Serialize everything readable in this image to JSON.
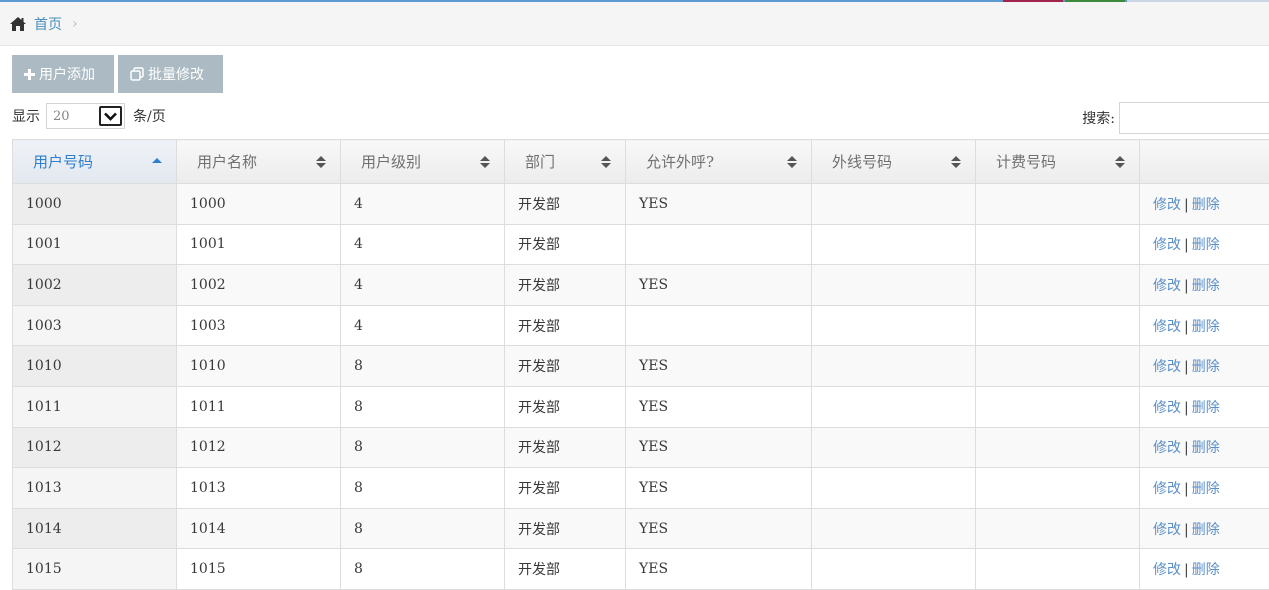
{
  "breadcrumb": {
    "home": "首页",
    "separator": "›"
  },
  "toolbar": {
    "add_label": "用户添加",
    "batch_label": "批量修改"
  },
  "length": {
    "prefix": "显示",
    "value": "20",
    "suffix": "条/页"
  },
  "search": {
    "label": "搜索:",
    "value": ""
  },
  "table": {
    "columns": [
      "用户号码",
      "用户名称",
      "用户级别",
      "部门",
      "允许外呼?",
      "外线号码",
      "计费号码",
      ""
    ],
    "sorted_column": 0,
    "rows": [
      {
        "number": "1000",
        "name": "1000",
        "level": "4",
        "dept": "开发部",
        "outbound": "YES",
        "trunk": "",
        "billing": ""
      },
      {
        "number": "1001",
        "name": "1001",
        "level": "4",
        "dept": "开发部",
        "outbound": "",
        "trunk": "",
        "billing": ""
      },
      {
        "number": "1002",
        "name": "1002",
        "level": "4",
        "dept": "开发部",
        "outbound": "YES",
        "trunk": "",
        "billing": ""
      },
      {
        "number": "1003",
        "name": "1003",
        "level": "4",
        "dept": "开发部",
        "outbound": "",
        "trunk": "",
        "billing": ""
      },
      {
        "number": "1010",
        "name": "1010",
        "level": "8",
        "dept": "开发部",
        "outbound": "YES",
        "trunk": "",
        "billing": ""
      },
      {
        "number": "1011",
        "name": "1011",
        "level": "8",
        "dept": "开发部",
        "outbound": "YES",
        "trunk": "",
        "billing": ""
      },
      {
        "number": "1012",
        "name": "1012",
        "level": "8",
        "dept": "开发部",
        "outbound": "YES",
        "trunk": "",
        "billing": ""
      },
      {
        "number": "1013",
        "name": "1013",
        "level": "8",
        "dept": "开发部",
        "outbound": "YES",
        "trunk": "",
        "billing": ""
      },
      {
        "number": "1014",
        "name": "1014",
        "level": "8",
        "dept": "开发部",
        "outbound": "YES",
        "trunk": "",
        "billing": ""
      },
      {
        "number": "1015",
        "name": "1015",
        "level": "8",
        "dept": "开发部",
        "outbound": "YES",
        "trunk": "",
        "billing": ""
      }
    ],
    "actions": {
      "edit": "修改",
      "separator": "|",
      "delete": "删除"
    }
  },
  "colors": {
    "accent": "#307ecc",
    "link": "#5b8fc7",
    "button": "#abbac3",
    "breadcrumb": "#4c8fbd"
  },
  "icons": {
    "home": "home-icon",
    "add": "plus-icon",
    "batch": "copy-icon",
    "select": "chevron-down-icon",
    "sort_active": "sort-up-icon",
    "sort": "sort-icon"
  }
}
